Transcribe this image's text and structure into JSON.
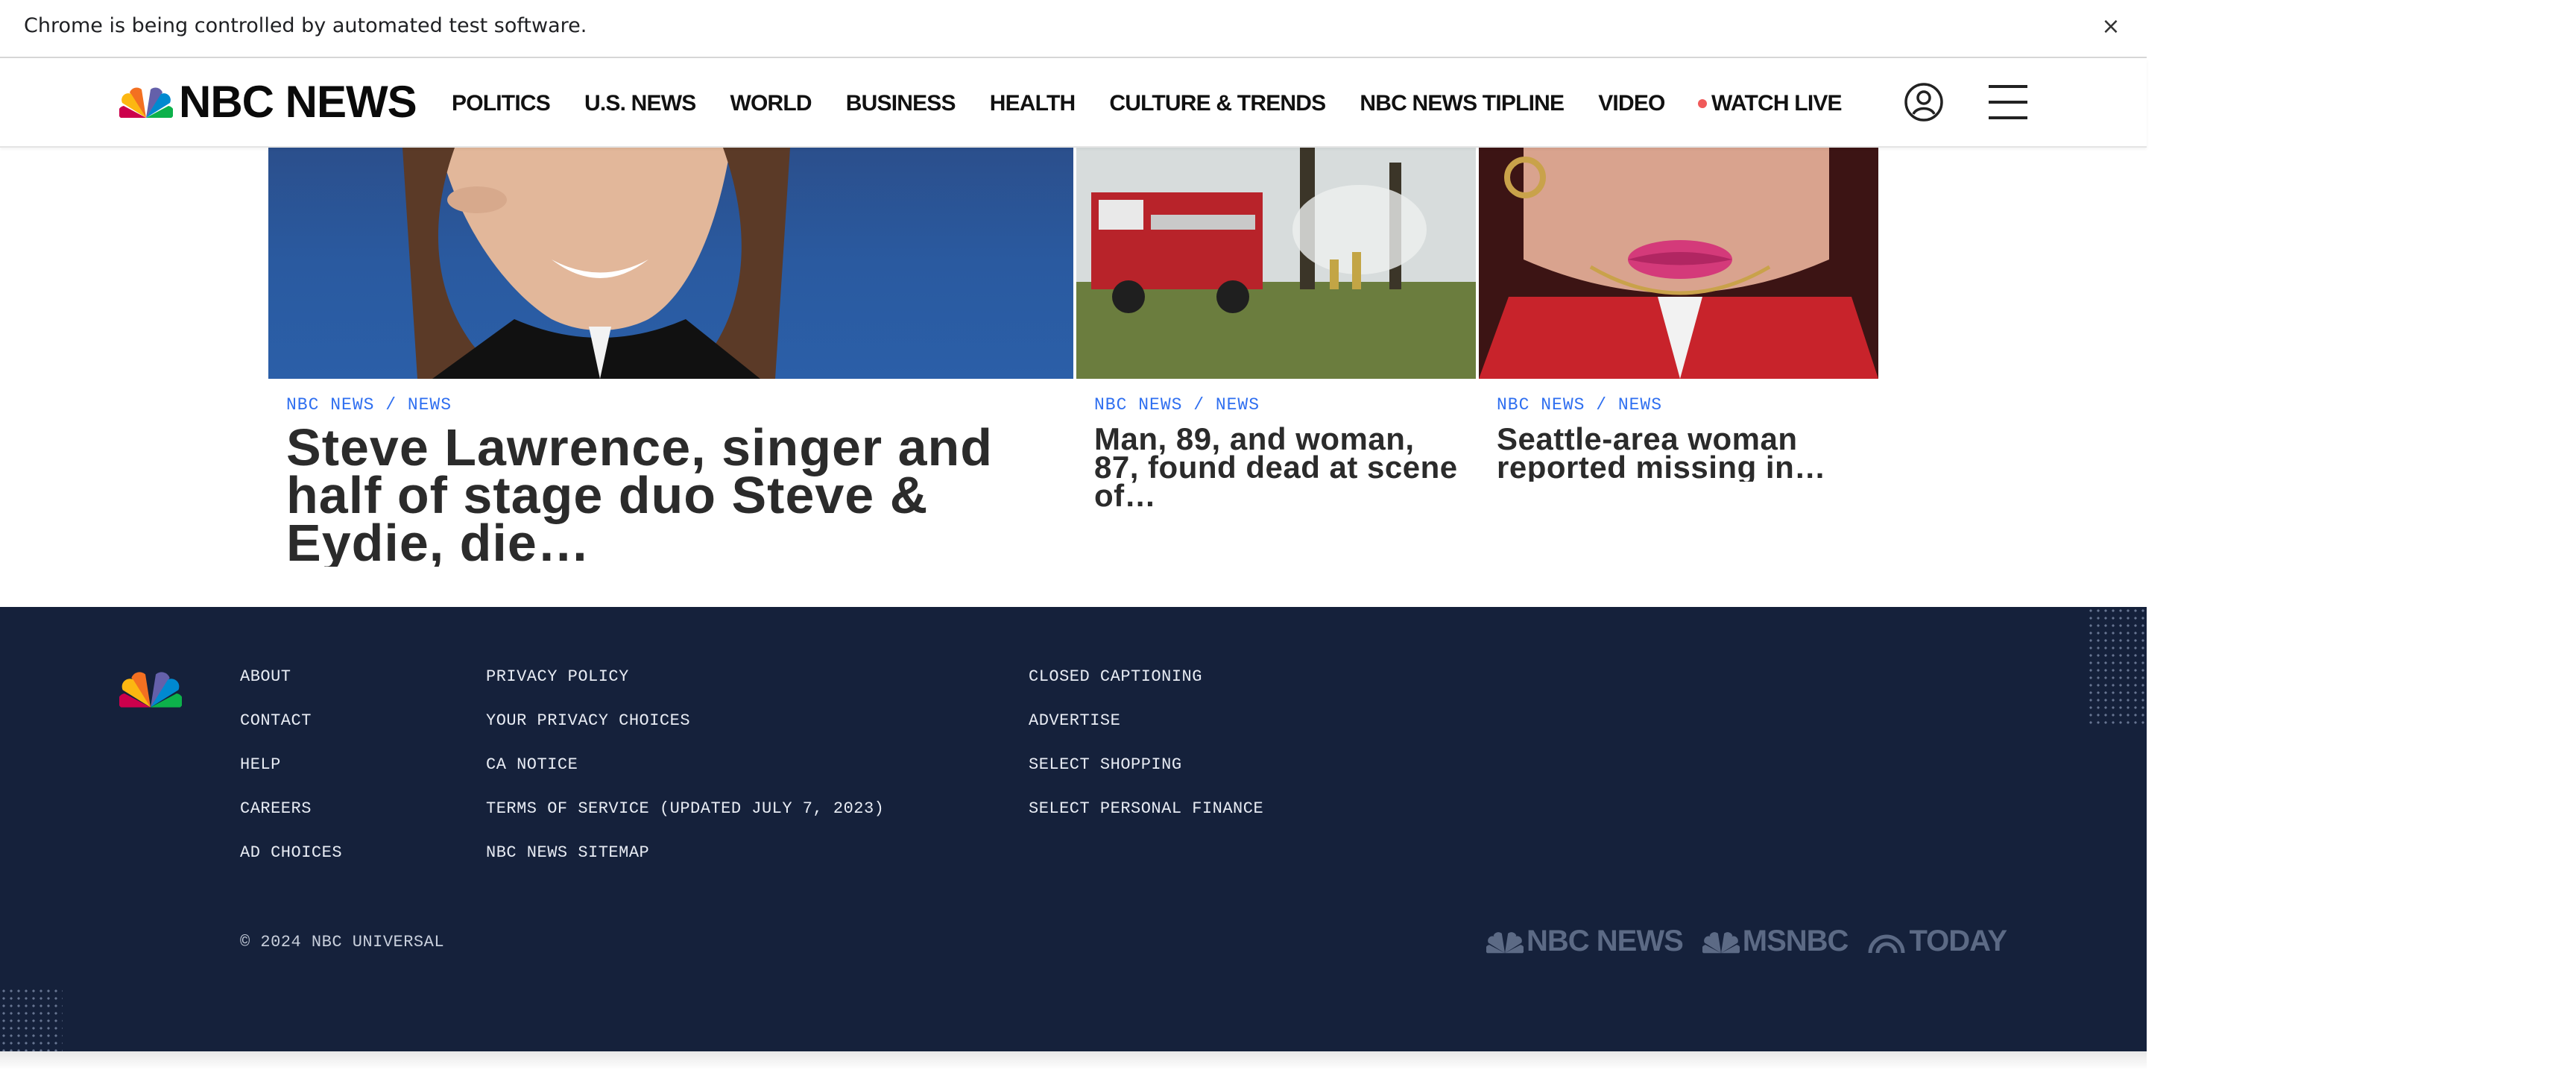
{
  "infobar": {
    "message": "Chrome is being controlled by automated test software.",
    "close_glyph": "×"
  },
  "header": {
    "logo_text": "NBC NEWS",
    "nav": [
      "POLITICS",
      "U.S. NEWS",
      "WORLD",
      "BUSINESS",
      "HEALTH",
      "CULTURE & TRENDS",
      "NBC NEWS TIPLINE",
      "VIDEO"
    ],
    "watch_live": "WATCH LIVE",
    "icons": {
      "account": "account-icon",
      "menu": "hamburger-menu-icon",
      "live": "live-dot-icon"
    }
  },
  "stories": [
    {
      "eyebrow": "NBC NEWS / NEWS",
      "headline": "Steve Lawrence, singer and half of stage duo Steve & Eydie, die…"
    },
    {
      "eyebrow": "NBC NEWS / NEWS",
      "headline": "Man, 89, and woman, 87, found dead at scene of…"
    },
    {
      "eyebrow": "NBC NEWS / NEWS",
      "headline": "Seattle-area woman reported missing in…"
    }
  ],
  "footer": {
    "col1": [
      "ABOUT",
      "CONTACT",
      "HELP",
      "CAREERS",
      "AD CHOICES"
    ],
    "col2": [
      "PRIVACY POLICY",
      "YOUR PRIVACY CHOICES",
      "CA NOTICE",
      "TERMS OF SERVICE (UPDATED JULY 7, 2023)",
      "NBC NEWS SITEMAP"
    ],
    "col3": [
      "CLOSED CAPTIONING",
      "ADVERTISE",
      "SELECT SHOPPING",
      "SELECT PERSONAL FINANCE"
    ],
    "copyright": "© 2024 NBC UNIVERSAL",
    "brands": [
      "NBC NEWS",
      "MSNBC",
      "TODAY"
    ]
  },
  "colors": {
    "eyebrow_blue": "#2f6ff0",
    "footer_navy": "#15213b",
    "live_red": "#f05a5a",
    "brand_gray": "#5c6a85"
  }
}
